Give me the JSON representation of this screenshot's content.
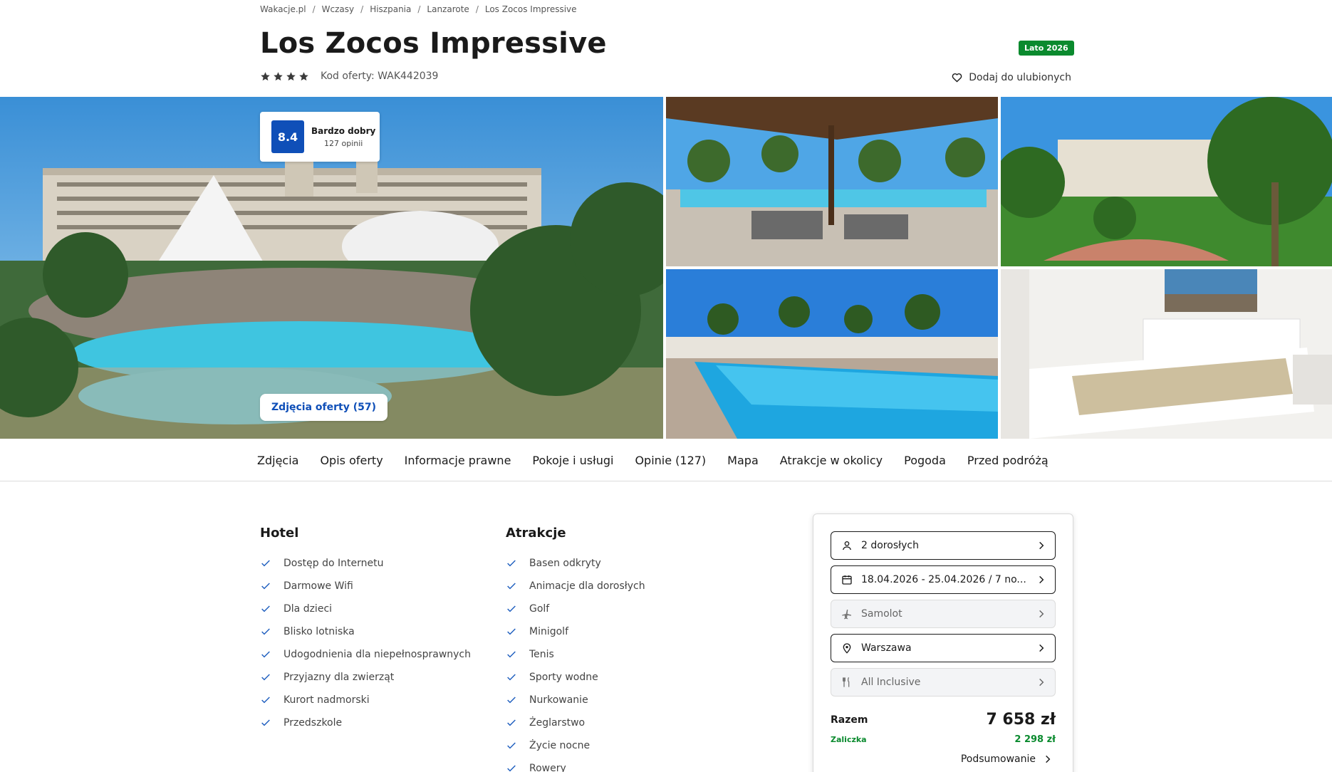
{
  "breadcrumb": [
    {
      "label": "Wakacje.pl"
    },
    {
      "label": "Wczasy"
    },
    {
      "label": "Hiszpania"
    },
    {
      "label": "Lanzarote"
    },
    {
      "label": "Los Zocos Impressive"
    }
  ],
  "hotel": {
    "name": "Los Zocos Impressive",
    "stars": 4,
    "offer_code": "Kod oferty: WAK442039",
    "season_badge": "Lato 2026",
    "favorite_label": "Dodaj do ulubionych"
  },
  "rating": {
    "score": "8.4",
    "label": "Bardzo dobry",
    "count": "127 opinii"
  },
  "gallery": {
    "photos_button": "Zdjęcia oferty (57)"
  },
  "tabs": [
    {
      "label": "Zdjęcia"
    },
    {
      "label": "Opis oferty"
    },
    {
      "label": "Informacje prawne"
    },
    {
      "label": "Pokoje i usługi"
    },
    {
      "label": "Opinie (127)"
    },
    {
      "label": "Mapa"
    },
    {
      "label": "Atrakcje w okolicy"
    },
    {
      "label": "Pogoda"
    },
    {
      "label": "Przed podróżą"
    }
  ],
  "hotel_features": {
    "title": "Hotel",
    "items": [
      "Dostęp do Internetu",
      "Darmowe Wifi",
      "Dla dzieci",
      "Blisko lotniska",
      "Udogodnienia dla niepełnosprawnych",
      "Przyjazny dla zwierząt",
      "Kurort nadmorski",
      "Przedszkole"
    ]
  },
  "attractions": {
    "title": "Atrakcje",
    "items": [
      "Basen odkryty",
      "Animacje dla dorosłych",
      "Golf",
      "Minigolf",
      "Tenis",
      "Sporty wodne",
      "Nurkowanie",
      "Żeglarstwo",
      "Życie nocne",
      "Rowery"
    ]
  },
  "booking": {
    "travellers": {
      "value": "2 dorosłych",
      "icon": "person-icon"
    },
    "dates": {
      "value": "18.04.2026 - 25.04.2026 / 7 no...",
      "icon": "calendar-icon"
    },
    "transport": {
      "value": "Samolot",
      "icon": "plane-icon"
    },
    "departure": {
      "value": "Warszawa",
      "icon": "location-pin-icon"
    },
    "board": {
      "value": "All Inclusive",
      "icon": "fork-knife-icon"
    },
    "total_label": "Razem",
    "total_value": "7 658 zł",
    "deposit_label": "Zaliczka",
    "deposit_value": "2 298 zł",
    "summary_label": "Podsumowanie"
  },
  "colors": {
    "brand_blue": "#0f4fb8",
    "success_green": "#0a8a2e",
    "check_blue": "#1f5fbf"
  }
}
